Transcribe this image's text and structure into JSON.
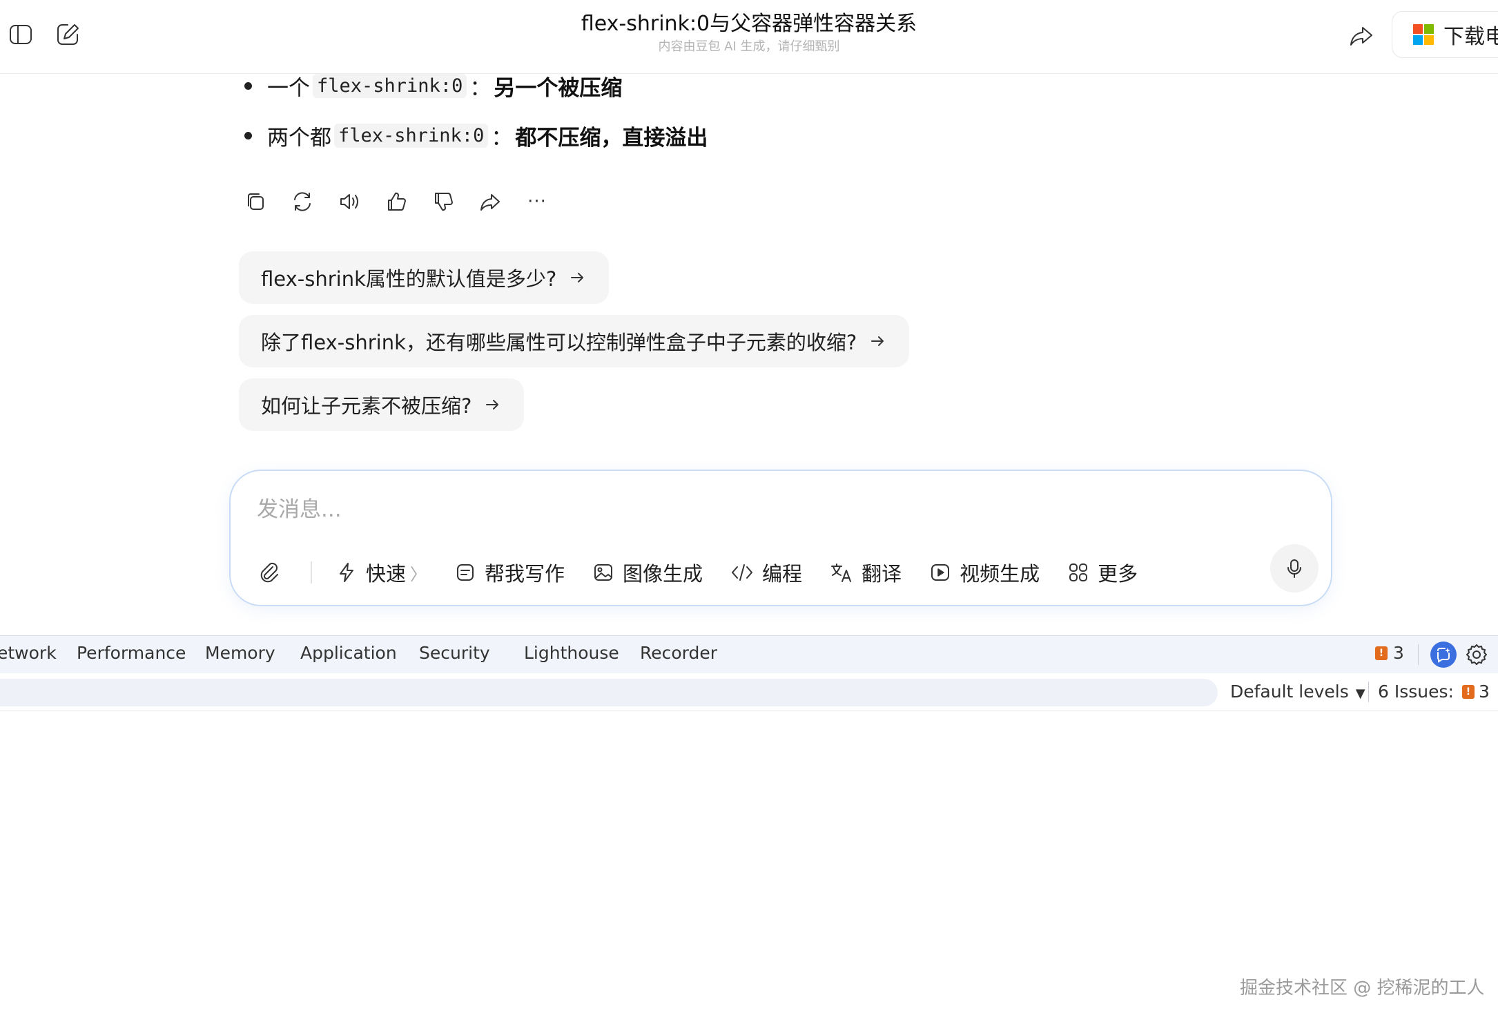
{
  "header": {
    "title": "flex-shrink:0与父容器弹性容器关系",
    "subtitle": "内容由豆包 AI 生成，请仔细甄别",
    "download_label": "下载电"
  },
  "answer": {
    "bullets": [
      {
        "prefix": "一个",
        "code": "flex-shrink:0",
        "sep": "：",
        "bold": "另一个被压缩"
      },
      {
        "prefix": "两个都",
        "code": "flex-shrink:0",
        "sep": "：",
        "bold": "都不压缩，直接溢出"
      }
    ],
    "action_icons": [
      "copy-icon",
      "regenerate-icon",
      "read-aloud-icon",
      "thumbs-up-icon",
      "thumbs-down-icon",
      "share-icon",
      "more-icon"
    ],
    "more_label": "···"
  },
  "suggestions": [
    "flex-shrink属性的默认值是多少?",
    "除了flex-shrink，还有哪些属性可以控制弹性盒子中子元素的收缩?",
    "如何让子元素不被压缩?"
  ],
  "composer": {
    "placeholder": "发消息...",
    "tools": {
      "quick": "快速",
      "write": "帮我写作",
      "image": "图像生成",
      "code": "编程",
      "translate": "翻译",
      "video": "视频生成",
      "more": "更多"
    },
    "chevron": "〉"
  },
  "devtools": {
    "tabs": [
      "etwork",
      "Performance",
      "Memory",
      "Application",
      "Security",
      "Lighthouse",
      "Recorder"
    ],
    "issue_badge_count": "3",
    "levels_label": "Default levels",
    "issues_label": "6 Issues:",
    "issues_warning_count": "3",
    "flag_glyph": "!",
    "dropdown_glyph": "▼"
  },
  "watermark": "掘金技术社区 @ 挖稀泥的工人",
  "colors": {
    "accent_blue": "#3b6fe0",
    "warning_orange": "#e36b1d",
    "composer_border": "#c9dcf6"
  }
}
